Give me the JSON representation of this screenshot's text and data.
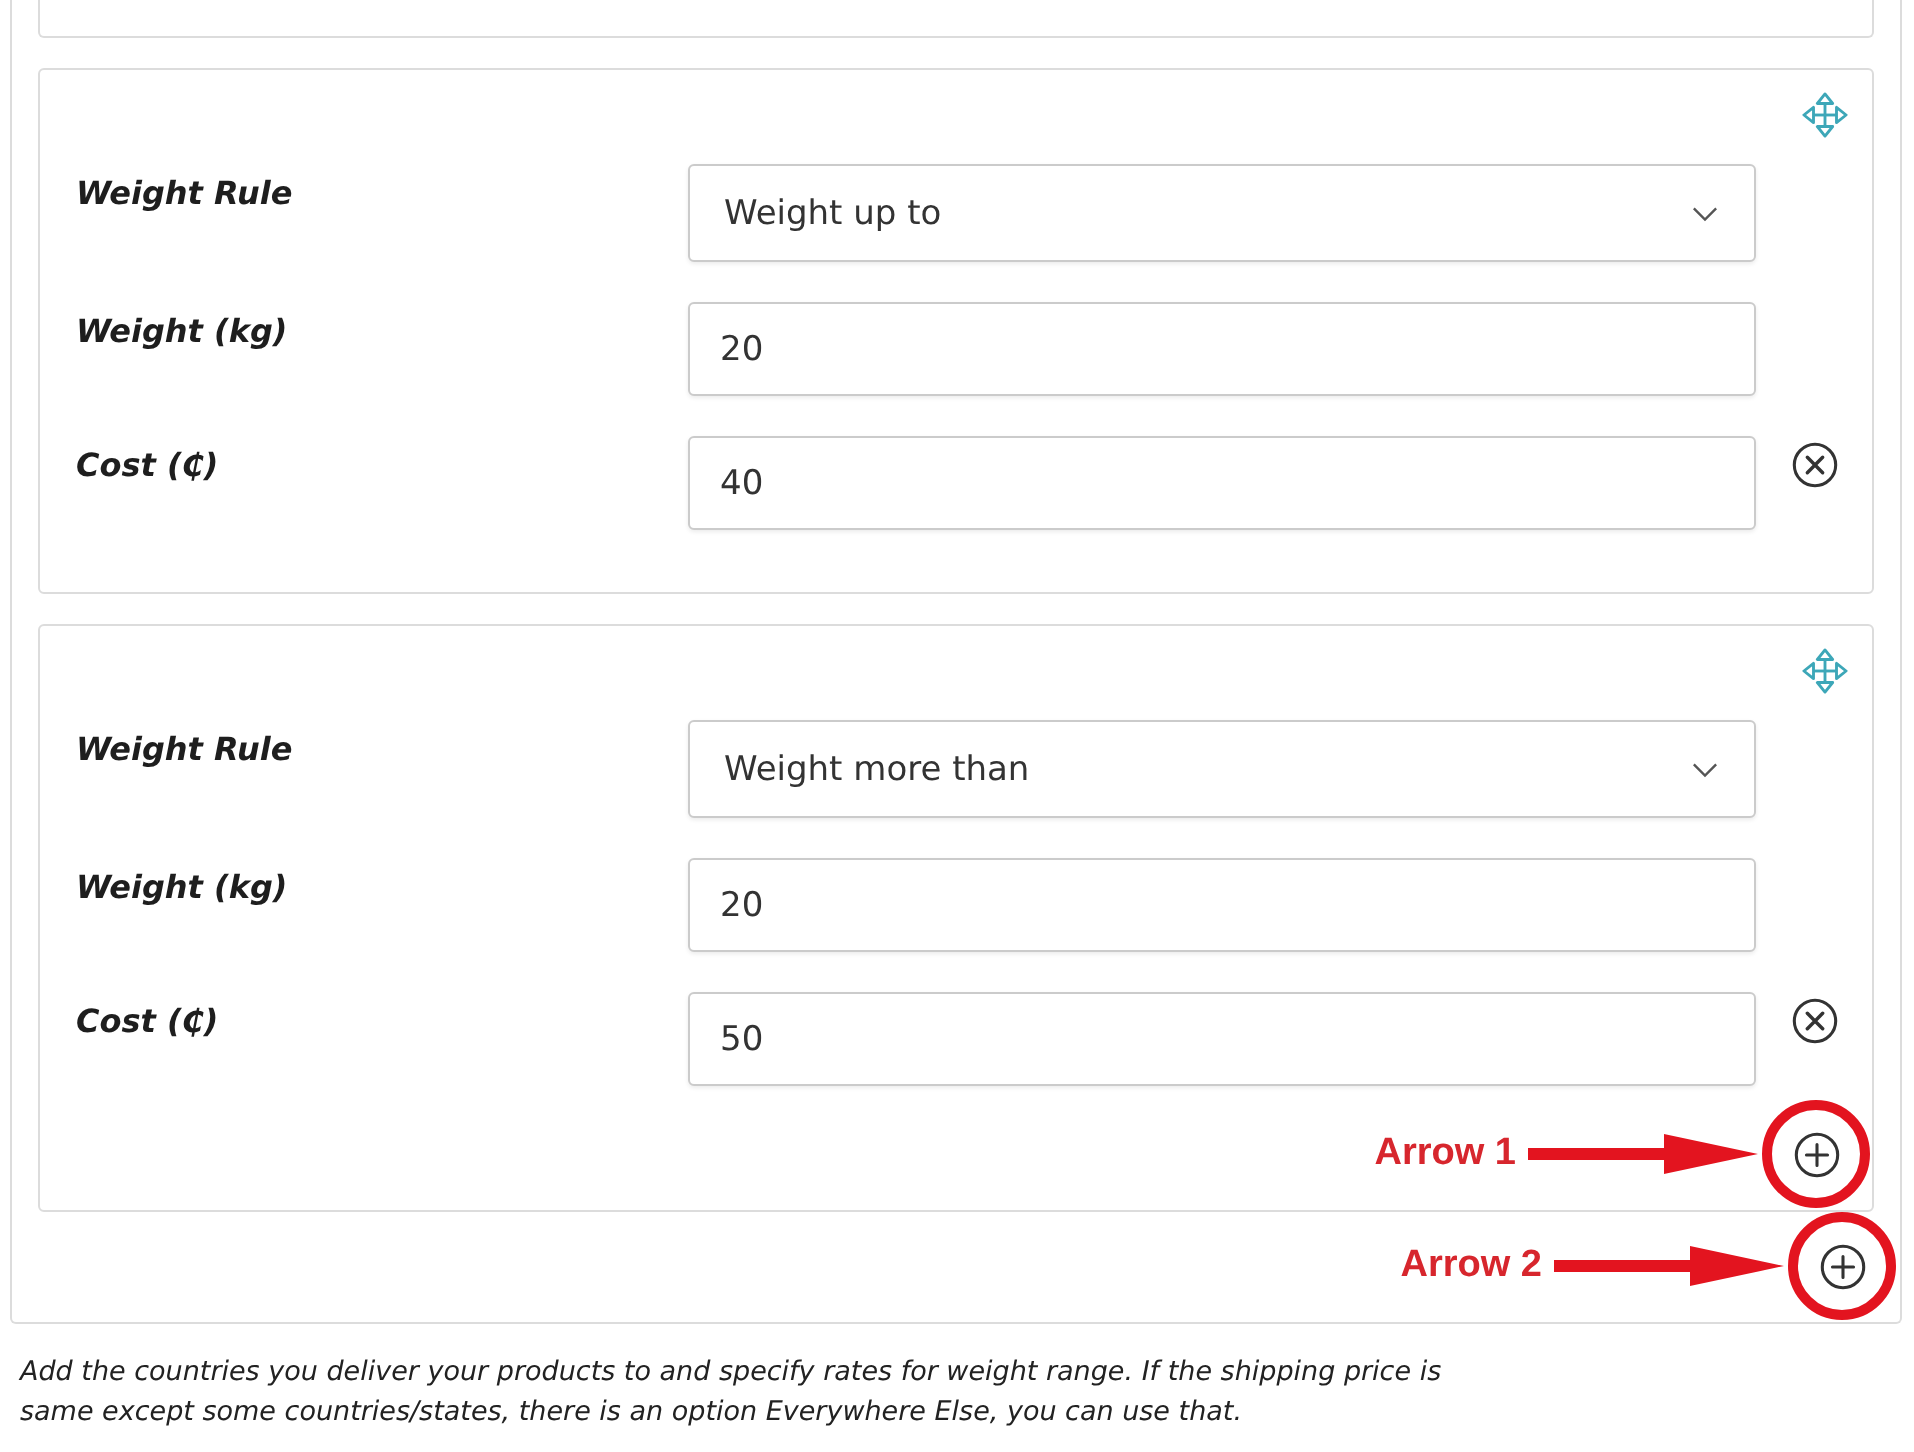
{
  "rules": [
    {
      "fields": [
        {
          "kind": "select",
          "label": "Weight Rule",
          "value": "Weight up to"
        },
        {
          "kind": "number",
          "label": "Weight (kg)",
          "value": "20"
        },
        {
          "kind": "number",
          "label": "Cost (₵)",
          "value": "40"
        }
      ]
    },
    {
      "fields": [
        {
          "kind": "select",
          "label": "Weight Rule",
          "value": "Weight more than"
        },
        {
          "kind": "number",
          "label": "Weight (kg)",
          "value": "20"
        },
        {
          "kind": "number",
          "label": "Cost (₵)",
          "value": "50"
        }
      ],
      "add_button": {
        "annotation": "Arrow 1"
      }
    }
  ],
  "add_rule_button": {
    "annotation": "Arrow 2"
  },
  "note": "Add the countries you deliver your products to and specify rates for weight range. If the shipping price is same except some countries/states, there is an option Everywhere Else, you can use that."
}
